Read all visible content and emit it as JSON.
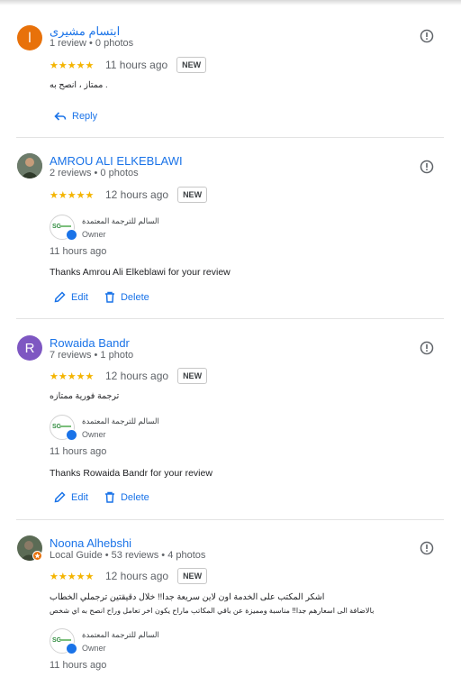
{
  "reviews": [
    {
      "reviewer": "ابتسام مشيرى",
      "avatar_letter": "ا",
      "avatar_color": "#e8710a",
      "meta": "1 review • 0 photos",
      "stars": "★★★★★",
      "time": "11 hours ago",
      "badge": "NEW",
      "text_lines": [
        "ممتاز ، انصح به ."
      ],
      "reply_action": "Reply"
    },
    {
      "reviewer": "AMROU ALI ELKEBLAWI",
      "meta": "2 reviews • 0 photos",
      "stars": "★★★★★",
      "time": "12 hours ago",
      "badge": "NEW",
      "owner": {
        "name": "السالم للترجمة المعتمدة",
        "role": "Owner",
        "logo_text": "SG"
      },
      "reply_time": "11 hours ago",
      "reply_text": "Thanks Amrou Ali Elkeblawi for your review",
      "edit_label": "Edit",
      "delete_label": "Delete"
    },
    {
      "reviewer": "Rowaida Bandr",
      "avatar_letter": "R",
      "avatar_color": "#7e57c2",
      "meta": "7 reviews • 1 photo",
      "stars": "★★★★★",
      "time": "12 hours ago",
      "badge": "NEW",
      "text_lines": [
        "ترجمة فورية ممتازه"
      ],
      "owner": {
        "name": "السالم للترجمة المعتمدة",
        "role": "Owner",
        "logo_text": "SG"
      },
      "reply_time": "11 hours ago",
      "reply_text": "Thanks Rowaida Bandr for your review",
      "edit_label": "Edit",
      "delete_label": "Delete"
    },
    {
      "reviewer": "Noona Alhebshi",
      "meta": "Local Guide • 53 reviews • 4 photos",
      "stars": "★★★★★",
      "time": "12 hours ago",
      "badge": "NEW",
      "text_lines": [
        "اشكر المكتب على الخدمة اون لاين سريعة جدا!! خلال دقيقتين ترجملي الخطاب",
        "بالاضافة الى اسعارهم جدا!! مناسبة ومميزة عن باقي المكاتب ماراح يكون اخر تعامل وراح انصح به اي شخص"
      ],
      "owner": {
        "name": "السالم للترجمة المعتمدة",
        "role": "Owner",
        "logo_text": "SG"
      },
      "reply_time": "11 hours ago"
    }
  ]
}
